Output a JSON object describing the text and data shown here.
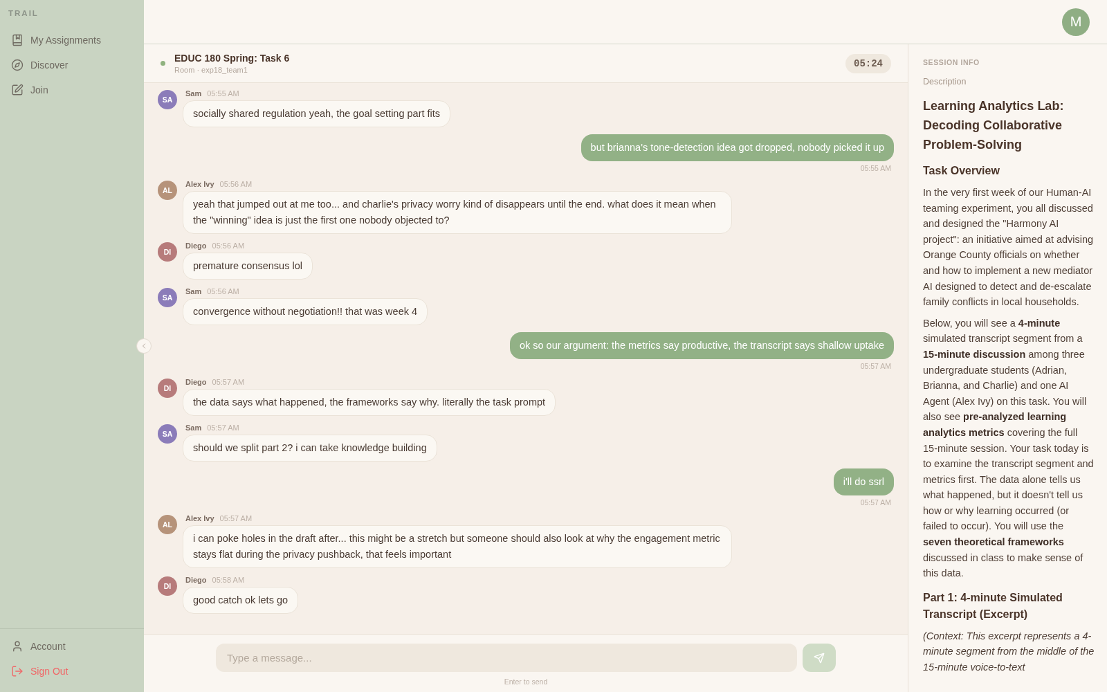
{
  "sidebar": {
    "brand": "TRAIL",
    "nav": [
      {
        "label": "My Assignments",
        "selected": false
      },
      {
        "label": "Discover",
        "selected": false
      },
      {
        "label": "Join",
        "selected": false
      }
    ],
    "footer": [
      {
        "label": "Account",
        "kind": "normal"
      },
      {
        "label": "Sign Out",
        "kind": "danger"
      }
    ]
  },
  "top_bar": {
    "user_initial": "M"
  },
  "chat": {
    "header": {
      "title": "EDUC 180 Spring: Task 6",
      "subtitle": "Room · exp18_team1",
      "online": true,
      "timer": "05:24"
    },
    "messages": [
      {
        "kind": "incoming",
        "sender": "Sam",
        "initials": "SA",
        "color": "#8b7cb9",
        "time": "05:55 AM",
        "text": "socially shared regulation yeah, the goal setting part fits"
      },
      {
        "kind": "outgoing",
        "time": "05:55 AM",
        "text": "but brianna's tone-detection idea got dropped, nobody picked it up"
      },
      {
        "kind": "incoming",
        "sender": "Alex Ivy",
        "initials": "AL",
        "color": "#b6937a",
        "time": "05:56 AM",
        "text": "yeah that jumped out at me too... and charlie's privacy worry kind of disappears until the end. what does it mean when the \"winning\" idea is just the first one nobody objected to?"
      },
      {
        "kind": "incoming",
        "sender": "Diego",
        "initials": "DI",
        "color": "#b77b7b",
        "time": "05:56 AM",
        "text": "premature consensus lol"
      },
      {
        "kind": "incoming",
        "sender": "Sam",
        "initials": "SA",
        "color": "#8b7cb9",
        "time": "05:56 AM",
        "text": "convergence without negotiation!! that was week 4"
      },
      {
        "kind": "outgoing",
        "time": "05:57 AM",
        "text": "ok so our argument: the metrics say productive, the transcript says shallow uptake"
      },
      {
        "kind": "incoming",
        "sender": "Diego",
        "initials": "DI",
        "color": "#b77b7b",
        "time": "05:57 AM",
        "text": "the data says what happened, the frameworks say why. literally the task prompt"
      },
      {
        "kind": "incoming",
        "sender": "Sam",
        "initials": "SA",
        "color": "#8b7cb9",
        "time": "05:57 AM",
        "text": "should we split part 2? i can take knowledge building"
      },
      {
        "kind": "outgoing",
        "time": "05:57 AM",
        "text": "i'll do ssrl"
      },
      {
        "kind": "incoming",
        "sender": "Alex Ivy",
        "initials": "AL",
        "color": "#b6937a",
        "time": "05:57 AM",
        "text": "i can poke holes in the draft after... this might be a stretch but someone should also look at why the engagement metric stays flat during the privacy pushback, that feels important"
      },
      {
        "kind": "incoming",
        "sender": "Diego",
        "initials": "DI",
        "color": "#b77b7b",
        "time": "05:58 AM",
        "text": "good catch ok lets go"
      }
    ],
    "composer": {
      "placeholder": "Type a message...",
      "send_disabled": true,
      "hint": "Enter to send"
    }
  },
  "session_info": {
    "heading": "SESSION INFO",
    "label": "Description",
    "title": "Learning Analytics Lab: Decoding Collaborative Problem-Solving",
    "blocks": [
      {
        "kind": "heading",
        "text": "Task Overview"
      },
      {
        "kind": "paragraph",
        "text": "In the very first week of our Human-AI teaming experiment, you all discussed and designed the \"Harmony AI project\": an initiative aimed at advising Orange County officials on whether and how to implement a new mediator AI designed to detect and de-escalate family conflicts in local households."
      },
      {
        "kind": "paragraph",
        "text": "Below, you will see a **4-minute** simulated transcript segment from a **15-minute discussion** among three undergraduate students (Adrian, Brianna, and Charlie) and one AI Agent (Alex Ivy) on this task. You will also see **pre-analyzed learning analytics metrics** covering the full 15-minute session. Your task today is to examine the transcript segment and metrics first. The data alone tells us what happened, but it doesn't tell us how or why learning occurred (or failed to occur). You will use the **seven theoretical frameworks** discussed in class to make sense of this data."
      },
      {
        "kind": "heading",
        "text": "Part 1: 4-minute Simulated Transcript (Excerpt)"
      },
      {
        "kind": "note",
        "text": "(Context: This excerpt represents a 4-minute segment from the middle of the 15-minute voice-to-text"
      }
    ]
  }
}
